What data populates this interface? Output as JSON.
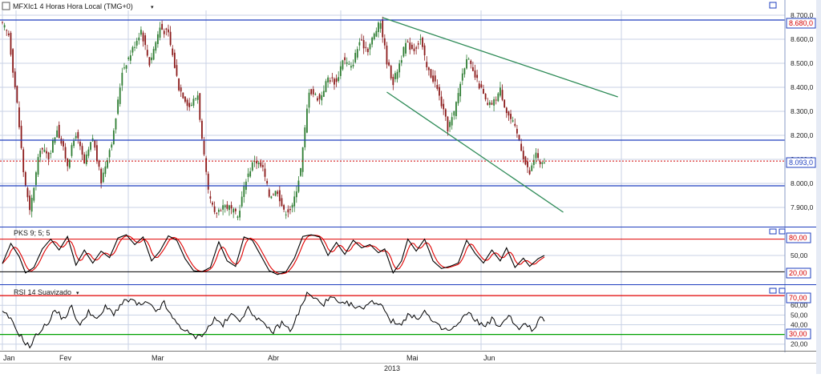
{
  "colors": {
    "background": "#ffffff",
    "grid": "#c8d2e6",
    "price_up": "#2e7d32",
    "price_down": "#8b1a1a",
    "hline": "#1f3fbf",
    "current_line": "#d40000",
    "trendline": "#2e8b57",
    "stoch_k": "#000000",
    "stoch_d": "#e00000",
    "rsi_line": "#000000",
    "level_high": "#e00000",
    "level_low_rsi": "#00a000",
    "level_low_stoch": "#000000"
  },
  "chart_data": [
    {
      "type": "candlestick",
      "title": "MFXIc1 4 Horas Hora Local (TMG+0)",
      "ylim": [
        7820,
        8720
      ],
      "y_ticks": [
        7900,
        8000,
        8100,
        8200,
        8300,
        8400,
        8500,
        8600,
        8700
      ],
      "y_tick_labels": [
        "7.900,0",
        "8.000,0",
        "8.100,0",
        "8.200,0",
        "8.300,0",
        "8.400,0",
        "8.500,0",
        "8.600,0",
        "8.700,0"
      ],
      "x_month_labels": [
        "Jan",
        "Fev",
        "Mar",
        "Abr",
        "Mai",
        "Jun"
      ],
      "x_year_label": "2013",
      "anchors": [
        {
          "i": 0,
          "p": 8660
        },
        {
          "i": 3,
          "p": 8620
        },
        {
          "i": 7,
          "p": 8330
        },
        {
          "i": 10,
          "p": 8050
        },
        {
          "i": 13,
          "p": 7880
        },
        {
          "i": 18,
          "p": 8150
        },
        {
          "i": 22,
          "p": 8110
        },
        {
          "i": 26,
          "p": 8230
        },
        {
          "i": 31,
          "p": 8080
        },
        {
          "i": 35,
          "p": 8210
        },
        {
          "i": 39,
          "p": 8080
        },
        {
          "i": 43,
          "p": 8190
        },
        {
          "i": 47,
          "p": 8010
        },
        {
          "i": 53,
          "p": 8210
        },
        {
          "i": 57,
          "p": 8470
        },
        {
          "i": 61,
          "p": 8540
        },
        {
          "i": 66,
          "p": 8640
        },
        {
          "i": 70,
          "p": 8500
        },
        {
          "i": 75,
          "p": 8650
        },
        {
          "i": 79,
          "p": 8620
        },
        {
          "i": 84,
          "p": 8400
        },
        {
          "i": 89,
          "p": 8320
        },
        {
          "i": 93,
          "p": 8370
        },
        {
          "i": 95,
          "p": 8180
        },
        {
          "i": 98,
          "p": 7960
        },
        {
          "i": 101,
          "p": 7870
        },
        {
          "i": 105,
          "p": 7910
        },
        {
          "i": 108,
          "p": 7900
        },
        {
          "i": 112,
          "p": 7860
        },
        {
          "i": 116,
          "p": 8020
        },
        {
          "i": 120,
          "p": 8100
        },
        {
          "i": 124,
          "p": 8060
        },
        {
          "i": 127,
          "p": 7950
        },
        {
          "i": 131,
          "p": 7970
        },
        {
          "i": 134,
          "p": 7880
        },
        {
          "i": 138,
          "p": 7900
        },
        {
          "i": 142,
          "p": 8060
        },
        {
          "i": 146,
          "p": 8390
        },
        {
          "i": 151,
          "p": 8350
        },
        {
          "i": 155,
          "p": 8440
        },
        {
          "i": 159,
          "p": 8420
        },
        {
          "i": 162,
          "p": 8520
        },
        {
          "i": 166,
          "p": 8480
        },
        {
          "i": 170,
          "p": 8590
        },
        {
          "i": 174,
          "p": 8560
        },
        {
          "i": 178,
          "p": 8640
        },
        {
          "i": 180,
          "p": 8670
        },
        {
          "i": 183,
          "p": 8510
        },
        {
          "i": 186,
          "p": 8420
        },
        {
          "i": 189,
          "p": 8500
        },
        {
          "i": 192,
          "p": 8580
        },
        {
          "i": 196,
          "p": 8560
        },
        {
          "i": 199,
          "p": 8600
        },
        {
          "i": 202,
          "p": 8480
        },
        {
          "i": 206,
          "p": 8420
        },
        {
          "i": 209,
          "p": 8330
        },
        {
          "i": 212,
          "p": 8230
        },
        {
          "i": 215,
          "p": 8290
        },
        {
          "i": 218,
          "p": 8420
        },
        {
          "i": 221,
          "p": 8530
        },
        {
          "i": 224,
          "p": 8460
        },
        {
          "i": 228,
          "p": 8390
        },
        {
          "i": 231,
          "p": 8320
        },
        {
          "i": 234,
          "p": 8340
        },
        {
          "i": 237,
          "p": 8390
        },
        {
          "i": 240,
          "p": 8300
        },
        {
          "i": 243,
          "p": 8250
        },
        {
          "i": 246,
          "p": 8180
        },
        {
          "i": 249,
          "p": 8080
        },
        {
          "i": 251,
          "p": 8040
        },
        {
          "i": 254,
          "p": 8130
        },
        {
          "i": 256,
          "p": 8070
        },
        {
          "i": 258,
          "p": 8093
        }
      ],
      "horizontal_lines": [
        8680,
        8180,
        7990
      ],
      "current_price": 8093,
      "current_price_label": "8.093,0",
      "top_line_label": "8.680,0",
      "trendlines": [
        {
          "i1": 181,
          "p1": 8690,
          "i2": 293,
          "p2": 8360
        },
        {
          "i1": 183,
          "p1": 8380,
          "i2": 267,
          "p2": 7880
        }
      ]
    },
    {
      "type": "line",
      "name": "PKS 9; 5; 5",
      "ylim": [
        0,
        100
      ],
      "y_ticks": [
        50
      ],
      "y_tick_labels": [
        "50,00"
      ],
      "levels": [
        80,
        20
      ],
      "level_labels": [
        "80,00",
        "20,00"
      ],
      "k_anchors": [
        {
          "i": 0,
          "v": 35
        },
        {
          "i": 4,
          "v": 72
        },
        {
          "i": 8,
          "v": 48
        },
        {
          "i": 11,
          "v": 18
        },
        {
          "i": 15,
          "v": 28
        },
        {
          "i": 19,
          "v": 62
        },
        {
          "i": 23,
          "v": 80
        },
        {
          "i": 27,
          "v": 60
        },
        {
          "i": 31,
          "v": 85
        },
        {
          "i": 35,
          "v": 32
        },
        {
          "i": 39,
          "v": 60
        },
        {
          "i": 43,
          "v": 36
        },
        {
          "i": 47,
          "v": 58
        },
        {
          "i": 51,
          "v": 46
        },
        {
          "i": 55,
          "v": 82
        },
        {
          "i": 59,
          "v": 88
        },
        {
          "i": 63,
          "v": 70
        },
        {
          "i": 67,
          "v": 84
        },
        {
          "i": 71,
          "v": 40
        },
        {
          "i": 75,
          "v": 58
        },
        {
          "i": 79,
          "v": 86
        },
        {
          "i": 83,
          "v": 78
        },
        {
          "i": 87,
          "v": 44
        },
        {
          "i": 91,
          "v": 22
        },
        {
          "i": 95,
          "v": 20
        },
        {
          "i": 99,
          "v": 28
        },
        {
          "i": 103,
          "v": 75
        },
        {
          "i": 107,
          "v": 40
        },
        {
          "i": 111,
          "v": 30
        },
        {
          "i": 115,
          "v": 84
        },
        {
          "i": 119,
          "v": 78
        },
        {
          "i": 123,
          "v": 50
        },
        {
          "i": 127,
          "v": 22
        },
        {
          "i": 131,
          "v": 15
        },
        {
          "i": 135,
          "v": 20
        },
        {
          "i": 139,
          "v": 45
        },
        {
          "i": 143,
          "v": 85
        },
        {
          "i": 147,
          "v": 88
        },
        {
          "i": 151,
          "v": 84
        },
        {
          "i": 155,
          "v": 50
        },
        {
          "i": 159,
          "v": 74
        },
        {
          "i": 163,
          "v": 52
        },
        {
          "i": 167,
          "v": 78
        },
        {
          "i": 171,
          "v": 64
        },
        {
          "i": 175,
          "v": 70
        },
        {
          "i": 179,
          "v": 55
        },
        {
          "i": 182,
          "v": 62
        },
        {
          "i": 186,
          "v": 18
        },
        {
          "i": 190,
          "v": 40
        },
        {
          "i": 193,
          "v": 80
        },
        {
          "i": 197,
          "v": 58
        },
        {
          "i": 201,
          "v": 80
        },
        {
          "i": 205,
          "v": 40
        },
        {
          "i": 209,
          "v": 26
        },
        {
          "i": 213,
          "v": 30
        },
        {
          "i": 217,
          "v": 36
        },
        {
          "i": 221,
          "v": 78
        },
        {
          "i": 225,
          "v": 54
        },
        {
          "i": 229,
          "v": 36
        },
        {
          "i": 233,
          "v": 60
        },
        {
          "i": 237,
          "v": 40
        },
        {
          "i": 240,
          "v": 64
        },
        {
          "i": 244,
          "v": 28
        },
        {
          "i": 248,
          "v": 45
        },
        {
          "i": 251,
          "v": 30
        },
        {
          "i": 255,
          "v": 44
        },
        {
          "i": 258,
          "v": 50
        }
      ]
    },
    {
      "type": "line",
      "name": "RSI 14 Suavizado",
      "ylim": [
        14,
        80
      ],
      "y_ticks": [
        20,
        40,
        50,
        60
      ],
      "y_tick_labels": [
        "20,00",
        "40,00",
        "50,00",
        "60,00"
      ],
      "levels": [
        70,
        30
      ],
      "level_labels": [
        "70,00",
        "30,00"
      ],
      "anchors": [
        {
          "i": 0,
          "v": 52
        },
        {
          "i": 3,
          "v": 48
        },
        {
          "i": 7,
          "v": 34
        },
        {
          "i": 10,
          "v": 24
        },
        {
          "i": 13,
          "v": 17
        },
        {
          "i": 17,
          "v": 32
        },
        {
          "i": 21,
          "v": 40
        },
        {
          "i": 25,
          "v": 55
        },
        {
          "i": 29,
          "v": 46
        },
        {
          "i": 33,
          "v": 58
        },
        {
          "i": 37,
          "v": 38
        },
        {
          "i": 41,
          "v": 55
        },
        {
          "i": 45,
          "v": 44
        },
        {
          "i": 49,
          "v": 58
        },
        {
          "i": 53,
          "v": 52
        },
        {
          "i": 57,
          "v": 62
        },
        {
          "i": 61,
          "v": 66
        },
        {
          "i": 65,
          "v": 60
        },
        {
          "i": 69,
          "v": 62
        },
        {
          "i": 73,
          "v": 54
        },
        {
          "i": 77,
          "v": 62
        },
        {
          "i": 81,
          "v": 46
        },
        {
          "i": 85,
          "v": 38
        },
        {
          "i": 89,
          "v": 30
        },
        {
          "i": 93,
          "v": 27
        },
        {
          "i": 97,
          "v": 34
        },
        {
          "i": 101,
          "v": 46
        },
        {
          "i": 105,
          "v": 40
        },
        {
          "i": 109,
          "v": 50
        },
        {
          "i": 113,
          "v": 46
        },
        {
          "i": 117,
          "v": 56
        },
        {
          "i": 121,
          "v": 48
        },
        {
          "i": 125,
          "v": 38
        },
        {
          "i": 129,
          "v": 33
        },
        {
          "i": 133,
          "v": 42
        },
        {
          "i": 137,
          "v": 34
        },
        {
          "i": 141,
          "v": 52
        },
        {
          "i": 145,
          "v": 72
        },
        {
          "i": 149,
          "v": 66
        },
        {
          "i": 153,
          "v": 62
        },
        {
          "i": 157,
          "v": 68
        },
        {
          "i": 161,
          "v": 60
        },
        {
          "i": 165,
          "v": 62
        },
        {
          "i": 169,
          "v": 56
        },
        {
          "i": 173,
          "v": 60
        },
        {
          "i": 177,
          "v": 64
        },
        {
          "i": 181,
          "v": 60
        },
        {
          "i": 185,
          "v": 44
        },
        {
          "i": 189,
          "v": 40
        },
        {
          "i": 193,
          "v": 50
        },
        {
          "i": 197,
          "v": 46
        },
        {
          "i": 201,
          "v": 54
        },
        {
          "i": 205,
          "v": 42
        },
        {
          "i": 209,
          "v": 36
        },
        {
          "i": 213,
          "v": 34
        },
        {
          "i": 217,
          "v": 40
        },
        {
          "i": 221,
          "v": 52
        },
        {
          "i": 225,
          "v": 46
        },
        {
          "i": 229,
          "v": 38
        },
        {
          "i": 233,
          "v": 46
        },
        {
          "i": 237,
          "v": 36
        },
        {
          "i": 241,
          "v": 52
        },
        {
          "i": 245,
          "v": 36
        },
        {
          "i": 249,
          "v": 40
        },
        {
          "i": 253,
          "v": 34
        },
        {
          "i": 256,
          "v": 46
        },
        {
          "i": 258,
          "v": 44
        }
      ]
    }
  ]
}
